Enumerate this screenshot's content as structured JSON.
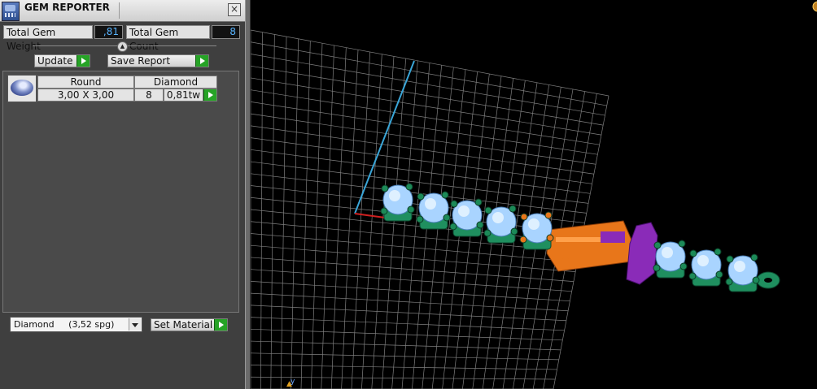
{
  "window": {
    "title": "GEM REPORTER",
    "close_symbol": "×"
  },
  "summary": {
    "weight_label": "Total Gem Weight",
    "weight_value": ",81",
    "count_label": "Total Gem Count",
    "count_value": "8"
  },
  "actions": {
    "update_label": "Update",
    "save_label": "Save Report"
  },
  "gem_table": {
    "shape": "Round",
    "size": "3,00 X 3,00",
    "material": "Diamond",
    "count": "8",
    "weight": "0,81tw"
  },
  "material_select": {
    "value": "Diamond     (3,52 spg)",
    "set_label": "Set Material"
  },
  "colors": {
    "gem": "#a9d4ff",
    "setting": "#1f8f5f",
    "clasp": "#e8761a",
    "hinge": "#8a2bb8",
    "grid": "#7f7f7f"
  }
}
